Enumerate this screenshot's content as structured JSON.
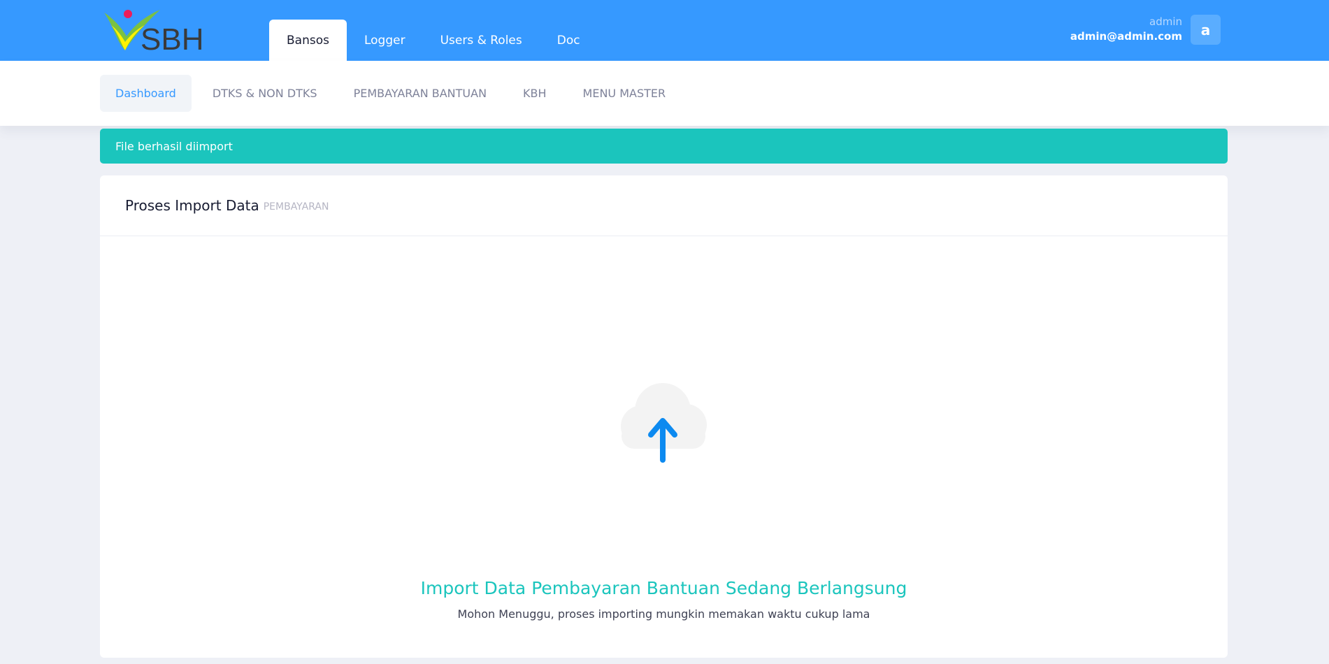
{
  "brand": {
    "logo_text": "SBH"
  },
  "top_tabs": [
    {
      "label": "Bansos",
      "active": true
    },
    {
      "label": "Logger",
      "active": false
    },
    {
      "label": "Users & Roles",
      "active": false
    },
    {
      "label": "Doc",
      "active": false
    }
  ],
  "user": {
    "name": "admin",
    "email": "admin@admin.com",
    "avatar_letter": "a"
  },
  "sub_nav": [
    {
      "label": "Dashboard",
      "active": true
    },
    {
      "label": "DTKS & NON DTKS",
      "active": false
    },
    {
      "label": "PEMBAYARAN BANTUAN",
      "active": false
    },
    {
      "label": "KBH",
      "active": false
    },
    {
      "label": "MENU MASTER",
      "active": false
    }
  ],
  "alert": {
    "text": "File berhasil diimport"
  },
  "card": {
    "title": "Proses Import Data",
    "subtitle": "PEMBAYARAN",
    "icon": "cloud-upload-icon",
    "message_title": "Import Data Pembayaran Bantuan Sedang Berlangsung",
    "message_sub": "Mohon Menuggu, proses importing mungkin memakan waktu cukup lama"
  },
  "colors": {
    "primary": "#3699ff",
    "success": "#1bc5bd",
    "background": "#eef0f6"
  }
}
